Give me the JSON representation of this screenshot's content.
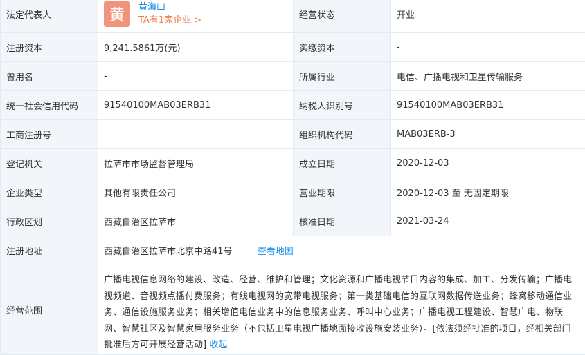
{
  "legal_rep": {
    "label": "法定代表人",
    "avatar_char": "黄",
    "name": "黄海山",
    "companies": "TA有1家企业 >"
  },
  "status": {
    "label": "经营状态",
    "value": "开业"
  },
  "reg_capital": {
    "label": "注册资本",
    "value": "9,241.5861万(元)"
  },
  "paid_capital": {
    "label": "实缴资本",
    "value": "-"
  },
  "former_name": {
    "label": "曾用名",
    "value": "-"
  },
  "industry": {
    "label": "所属行业",
    "value": "电信、广播电视和卫星传输服务"
  },
  "credit_code": {
    "label": "统一社会信用代码",
    "value": "91540100MAB03ERB31"
  },
  "taxpayer_id": {
    "label": "纳税人识别号",
    "value": "91540100MAB03ERB31"
  },
  "reg_number": {
    "label": "工商注册号",
    "value": ""
  },
  "org_code": {
    "label": "组织机构代码",
    "value": "MAB03ERB-3"
  },
  "authority": {
    "label": "登记机关",
    "value": "拉萨市市场监督管理局"
  },
  "established": {
    "label": "成立日期",
    "value": "2020-12-03"
  },
  "company_type": {
    "label": "企业类型",
    "value": "其他有限责任公司"
  },
  "term": {
    "label": "营业期限",
    "value": "2020-12-03 至 无固定期限"
  },
  "region": {
    "label": "行政区划",
    "value": "西藏自治区拉萨市"
  },
  "approved": {
    "label": "核准日期",
    "value": "2021-03-24"
  },
  "address": {
    "label": "注册地址",
    "value": "西藏自治区拉萨市北京中路41号",
    "map_link": "查看地图"
  },
  "scope": {
    "label": "经营范围",
    "value": "广播电视信息网络的建设、改造、经营、维护和管理；文化资源和广播电视节目内容的集成、加工、分发传输；广播电视频道、音视频点播付费服务；有线电视网的宽带电视服务；第一类基础电信的互联网数据传送业务；蜂窝移动通信业务、通信设施服务业务；相关增值电信业务中的信息服务业务、呼叫中心业务；广播电视工程建设、智慧广电、物联网、智慧社区及智慧家居服务业务（不包括卫星电视广播地面接收设施安装业务）。[依法须经批准的项目，经相关部门批准后方可开展经营活动]",
    "collapse": "收起"
  }
}
